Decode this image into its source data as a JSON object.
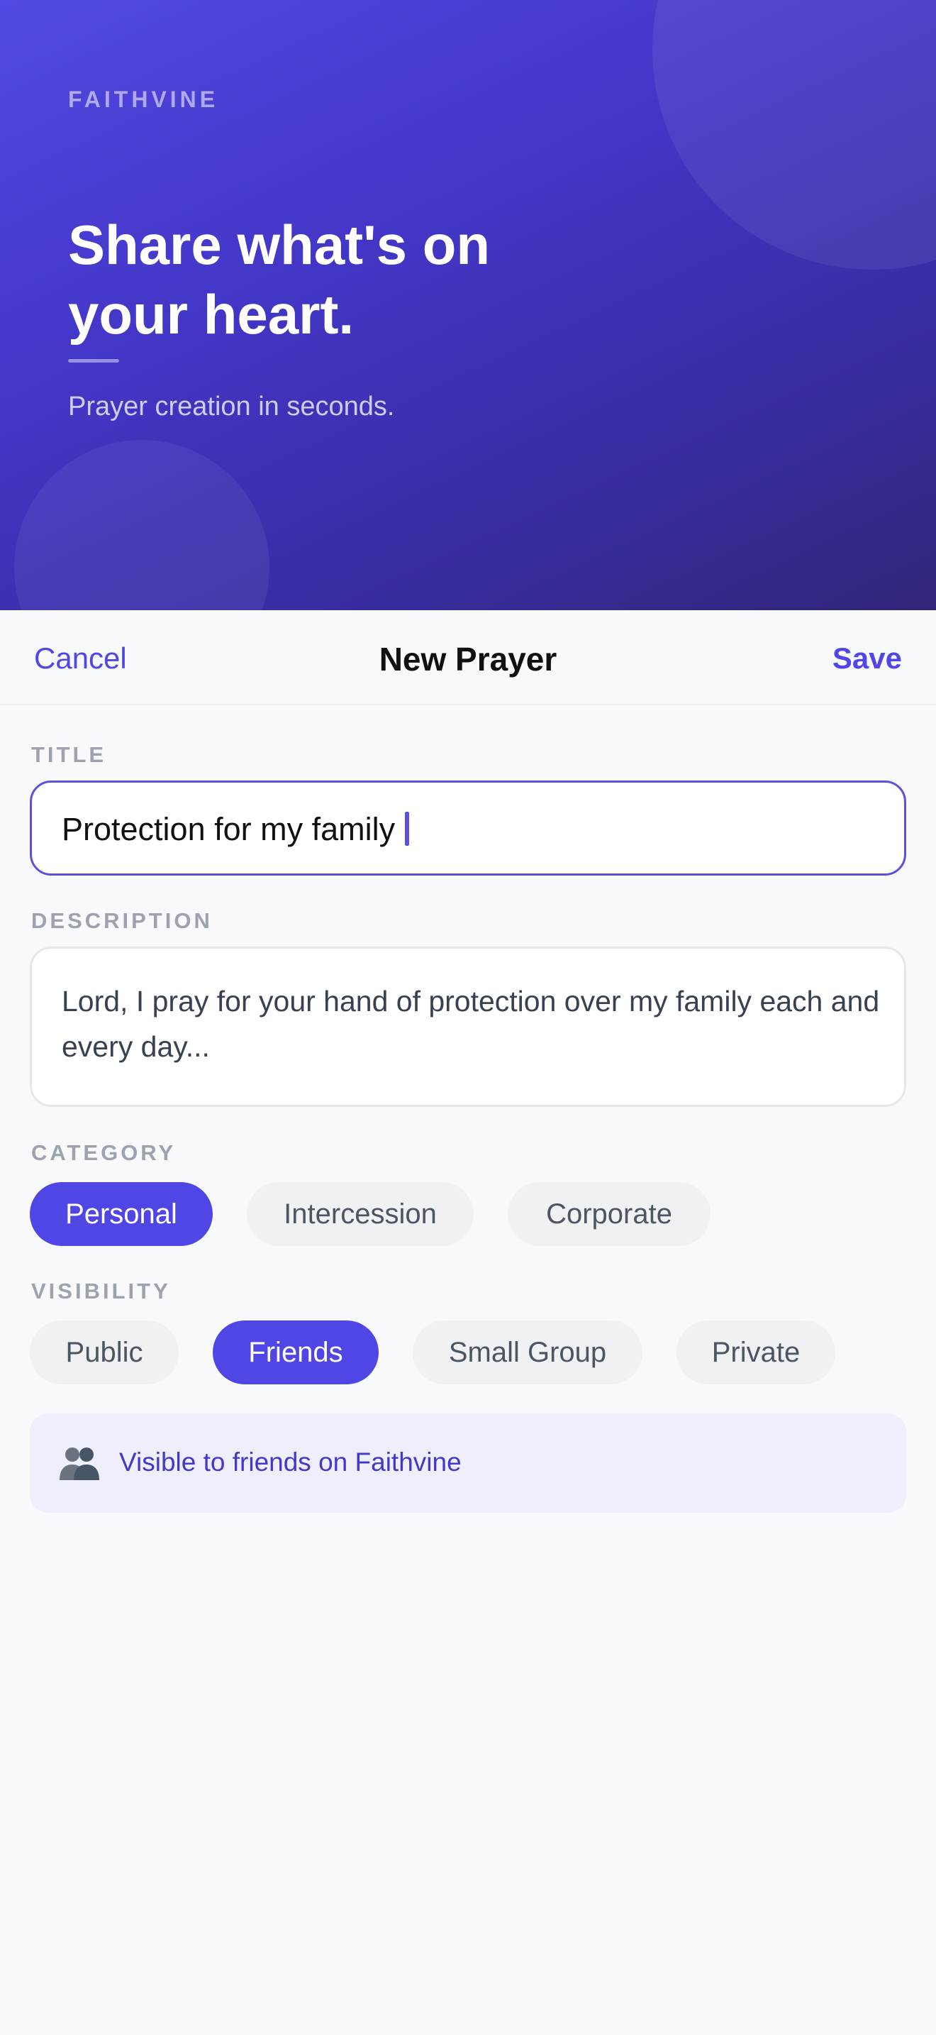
{
  "hero": {
    "brand": "FAITHVINE",
    "headline_line1": "Share what's on",
    "headline_line2": "your heart.",
    "subline": "Prayer creation in seconds."
  },
  "navbar": {
    "cancel_label": "Cancel",
    "title": "New Prayer",
    "save_label": "Save"
  },
  "form": {
    "title_label": "TITLE",
    "title_value": "Protection for my family",
    "description_label": "DESCRIPTION",
    "description_value": "Lord, I pray for your hand of protection over my family each and every day...",
    "category_label": "CATEGORY",
    "categories": [
      "Personal",
      "Intercession",
      "Corporate"
    ],
    "selected_category": "Personal",
    "visibility_label": "VISIBILITY",
    "visibility_options": [
      "Public",
      "Friends",
      "Small Group",
      "Private"
    ],
    "selected_visibility": "Friends",
    "visibility_note": "Visible to friends on Faithvine",
    "visibility_note_icon": "people-icon"
  },
  "colors": {
    "accent": "#4F46E5",
    "hero_gradient_start": "#5249E2",
    "hero_gradient_end": "#2F2678",
    "chip_inactive_bg": "#F0F1F3",
    "info_box_bg": "#EEEEFC"
  }
}
